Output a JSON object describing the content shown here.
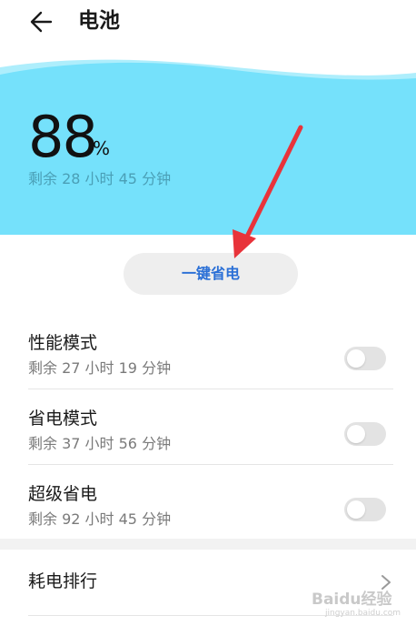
{
  "header": {
    "title": "电池",
    "back_icon": "arrow-left-icon"
  },
  "battery": {
    "percent": "88",
    "unit": "%",
    "remaining": "剩余 28 小时 45 分钟",
    "panel_color": "#75e1fb"
  },
  "one_key": {
    "label": "一键省电",
    "color": "#2a6fd6"
  },
  "modes": [
    {
      "title": "性能模式",
      "remaining": "剩余 27 小时 19 分钟",
      "enabled": false
    },
    {
      "title": "省电模式",
      "remaining": "剩余 37 小时 56 分钟",
      "enabled": false
    },
    {
      "title": "超级省电",
      "remaining": "剩余 92 小时 45 分钟",
      "enabled": false
    }
  ],
  "ranking": {
    "label": "耗电排行",
    "chevron_icon": "chevron-right-icon"
  },
  "watermark": {
    "text": "Baidu经验",
    "sub": "jingyan.baidu.com"
  },
  "annotation": {
    "arrow_color": "#e8333a"
  }
}
